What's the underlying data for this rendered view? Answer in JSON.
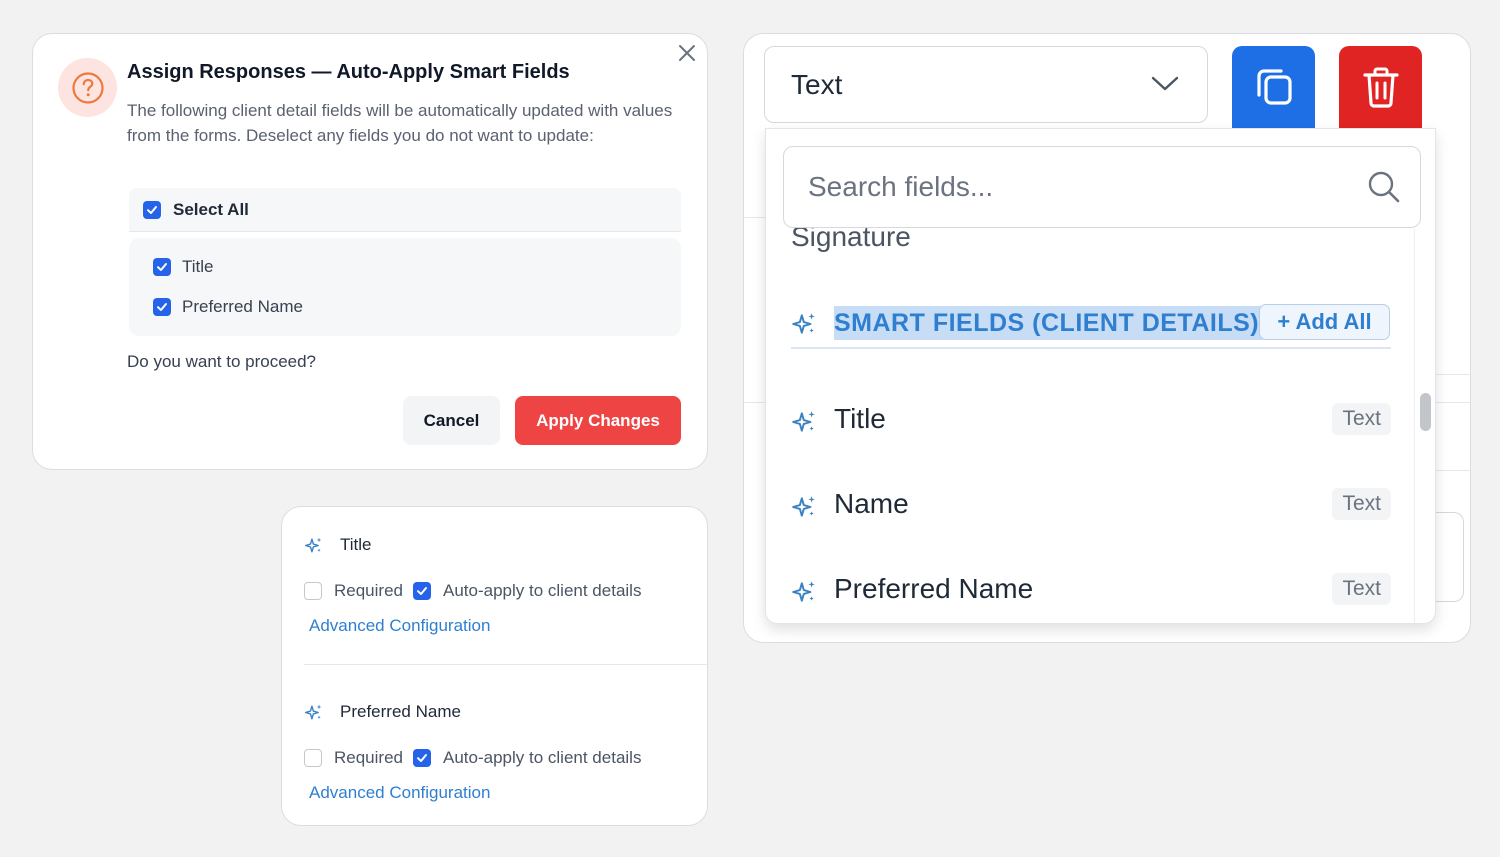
{
  "dialog": {
    "title": "Assign Responses — Auto-Apply Smart Fields",
    "description": "The following client detail fields will be automatically updated with values from the forms. Deselect any fields you do not want to update:",
    "select_all_label": "Select All",
    "fields": [
      {
        "label": "Title",
        "checked": true
      },
      {
        "label": "Preferred Name",
        "checked": true
      }
    ],
    "question": "Do you want to proceed?",
    "cancel_label": "Cancel",
    "apply_label": "Apply Changes",
    "icon": "question-circle-icon",
    "accent_color": "#ef4444"
  },
  "field_config": [
    {
      "title": "Title",
      "required_label": "Required",
      "required_checked": false,
      "auto_apply_label": "Auto-apply to client details",
      "auto_apply_checked": true,
      "link_label": "Advanced Configuration"
    },
    {
      "title": "Preferred Name",
      "required_label": "Required",
      "required_checked": false,
      "auto_apply_label": "Auto-apply to client details",
      "auto_apply_checked": true,
      "link_label": "Advanced Configuration"
    }
  ],
  "panel": {
    "type_select_value": "Text",
    "search_placeholder": "Search fields...",
    "partial_item": "Signature",
    "group_label": "SMART FIELDS (CLIENT DETAILS)",
    "add_all_label": "+ Add All",
    "options": [
      {
        "label": "Title",
        "type": "Text"
      },
      {
        "label": "Name",
        "type": "Text"
      },
      {
        "label": "Preferred Name",
        "type": "Text"
      }
    ],
    "copy_color": "#1e6fe6",
    "delete_color": "#e02424",
    "link_color": "#2f7fd1"
  }
}
